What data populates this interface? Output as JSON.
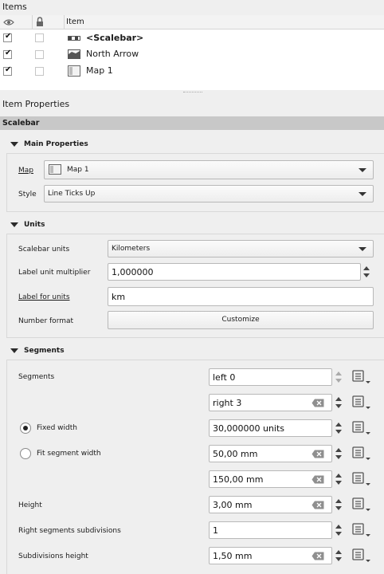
{
  "items_panel": {
    "title": "Items",
    "header_label": "Item",
    "rows": [
      {
        "label": "<Scalebar>",
        "visible": true,
        "locked": false,
        "icon": "scalebar-icon"
      },
      {
        "label": "North Arrow",
        "visible": true,
        "locked": false,
        "icon": "north-arrow-icon"
      },
      {
        "label": "Map 1",
        "visible": true,
        "locked": false,
        "icon": "map-icon"
      }
    ]
  },
  "properties": {
    "title": "Item Properties",
    "item_type": "Scalebar",
    "main": {
      "section": "Main Properties",
      "map_label": "Map",
      "map_value": "Map 1",
      "style_label": "Style",
      "style_value": "Line Ticks Up"
    },
    "units": {
      "section": "Units",
      "scalebar_units_label": "Scalebar units",
      "scalebar_units_value": "Kilometers",
      "multiplier_label": "Label unit multiplier",
      "multiplier_value": "1,000000",
      "label_for_units_label": "Label for units",
      "label_for_units_value": "km",
      "number_format_label": "Number format",
      "customize_button": "Customize"
    },
    "segments": {
      "section": "Segments",
      "segments_label": "Segments",
      "left_value": "left 0",
      "right_value": "right 3",
      "fixed_width_label": "Fixed width",
      "fixed_width_value": "30,000000 units",
      "fixed_width_selected": true,
      "fit_label": "Fit segment width",
      "fit_min_value": "50,00 mm",
      "fit_max_value": "150,00 mm",
      "height_label": "Height",
      "height_value": "3,00 mm",
      "subdivisions_label": "Right segments subdivisions",
      "subdivisions_value": "1",
      "subdivisions_height_label": "Subdivisions height",
      "subdivisions_height_value": "1,50 mm"
    }
  }
}
